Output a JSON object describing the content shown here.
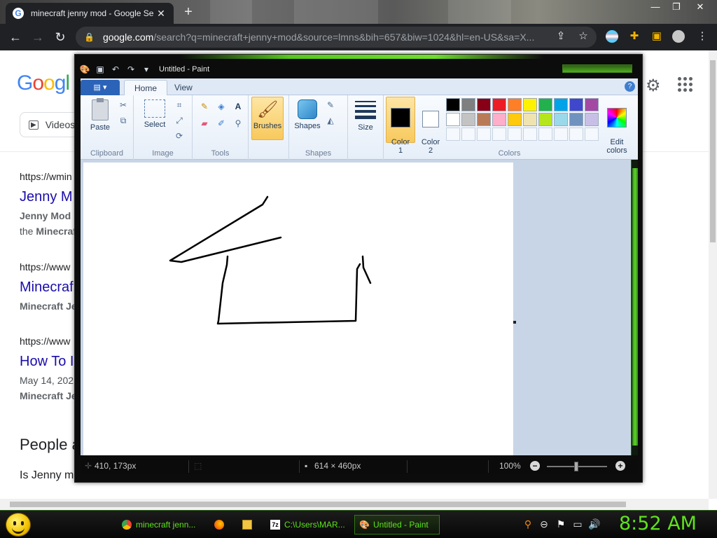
{
  "browser": {
    "tab_title": "minecraft jenny mod - Google Se",
    "tab_close": "✕",
    "new_tab": "+",
    "window_controls": [
      "—",
      "❐",
      "✕"
    ],
    "back": "←",
    "forward": "→",
    "reload": "↻",
    "url_host": "google.com",
    "url_rest": "/search?q=minecraft+jenny+mod&source=lmns&bih=657&biw=1024&hl=en-US&sa=X...",
    "share_icon": "⇪",
    "star_icon": "☆"
  },
  "google": {
    "logo": [
      "G",
      "o",
      "o",
      "g",
      "l"
    ],
    "videos_chip": "Videos",
    "gear": "⚙",
    "results": [
      {
        "url": "https://wmin",
        "title": "Jenny M",
        "snippet_bold": "Jenny Mod",
        "snippet_rest": "·",
        "snippet2_pre": "the ",
        "snippet2_bold": "Minecraf"
      },
      {
        "url": "https://www",
        "title": "Minecraf",
        "snippet_bold": "Minecraft Je"
      },
      {
        "url": "https://www",
        "title": "How To I",
        "date": "May 14, 202",
        "snippet_bold": "Minecraft Je"
      }
    ],
    "people_also_ask": "People a",
    "paa_question": "Is Jenny m"
  },
  "paint": {
    "window_title": "Untitled - Paint",
    "qa_icons": [
      "▣",
      "↶",
      "↷",
      "▾"
    ],
    "file_menu": "▤ ▾",
    "tabs": [
      "Home",
      "View"
    ],
    "help": "?",
    "groups": {
      "clipboard": {
        "label": "Clipboard",
        "paste": "Paste"
      },
      "image": {
        "label": "Image",
        "select": "Select"
      },
      "tools": {
        "label": "Tools"
      },
      "brushes": {
        "label": "Brushes"
      },
      "shapes": {
        "label": "Shapes",
        "shapes": "Shapes"
      },
      "size": {
        "label": "Size"
      },
      "colors": {
        "label": "Colors",
        "color1": "Color\n1",
        "color2": "Color\n2",
        "edit": "Edit\ncolors"
      }
    },
    "palette": [
      "#000000",
      "#7f7f7f",
      "#880015",
      "#ed1c24",
      "#ff7f27",
      "#fff200",
      "#22b14c",
      "#00a2e8",
      "#3f48cc",
      "#a349a4",
      "#ffffff",
      "#c3c3c3",
      "#b97a57",
      "#ffaec9",
      "#ffc90e",
      "#efe4b0",
      "#b5e61d",
      "#99d9ea",
      "#7092be",
      "#c8bfe7"
    ],
    "color1": "#000000",
    "color2": "#ffffff",
    "status": {
      "cursor_pos": "410, 173px",
      "canvas_size": "614 × 460px",
      "zoom": "100%",
      "zoom_out": "−",
      "zoom_in": "+"
    }
  },
  "taskbar": {
    "tasks": [
      {
        "label": "minecraft jenn..."
      },
      {
        "label": ""
      },
      {
        "label": ""
      },
      {
        "label": "C:\\Users\\MAR..."
      },
      {
        "label": "Untitled - Paint"
      }
    ],
    "clock": "8:52 AM"
  }
}
